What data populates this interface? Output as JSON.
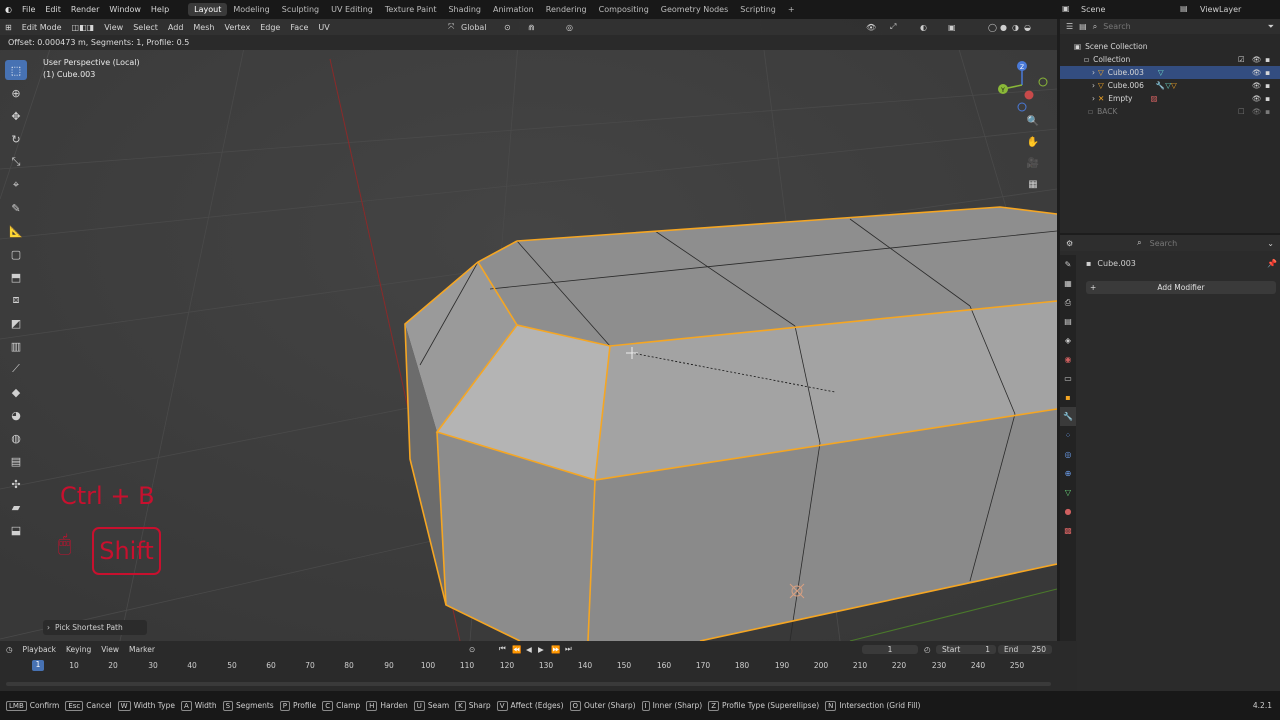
{
  "menubar": {
    "menus": [
      "File",
      "Edit",
      "Render",
      "Window",
      "Help"
    ],
    "workspaces": [
      "Layout",
      "Modeling",
      "Sculpting",
      "UV Editing",
      "Texture Paint",
      "Shading",
      "Animation",
      "Rendering",
      "Compositing",
      "Geometry Nodes",
      "Scripting"
    ],
    "active_workspace": "Layout",
    "scene": "Scene",
    "view_layer": "ViewLayer"
  },
  "viewport_header": {
    "mode": "Edit Mode",
    "menus": [
      "View",
      "Select",
      "Add",
      "Mesh",
      "Vertex",
      "Edge",
      "Face",
      "UV"
    ],
    "orientation": "Global"
  },
  "operator_status": "Offset: 0.000473 m, Segments: 1, Profile: 0.5",
  "viewport_overlay": {
    "view_name": "User Perspective (Local)",
    "object": "(1) Cube.003"
  },
  "gizmo_axes": {
    "z": "Z",
    "y": "Y"
  },
  "shortcut_overlay": {
    "combo": "Ctrl + B",
    "modifier": "Shift"
  },
  "last_operator_panel": "Pick Shortest Path",
  "outliner": {
    "search_placeholder": "Search",
    "scene_collection": "Scene Collection",
    "collection": "Collection",
    "items": [
      "Cube.003",
      "Cube.006",
      "Empty",
      "BACK"
    ]
  },
  "properties": {
    "search_placeholder": "Search",
    "object_name": "Cube.003",
    "add_modifier": "Add Modifier"
  },
  "timeline": {
    "menus": [
      "Playback",
      "Keying",
      "View",
      "Marker"
    ],
    "current_frame": "1",
    "start_label": "Start",
    "start": "1",
    "end_label": "End",
    "end": "250",
    "ticks": [
      "10",
      "20",
      "30",
      "40",
      "50",
      "60",
      "70",
      "80",
      "90",
      "100",
      "110",
      "120",
      "130",
      "140",
      "150",
      "160",
      "170",
      "180",
      "190",
      "200",
      "210",
      "220",
      "230",
      "240",
      "250"
    ]
  },
  "statusbar": {
    "hints": [
      {
        "key": "LMB",
        "label": "Confirm"
      },
      {
        "key": "Esc",
        "label": "Cancel"
      },
      {
        "key": "W",
        "label": "Width Type"
      },
      {
        "key": "A",
        "label": "Width"
      },
      {
        "key": "S",
        "label": "Segments"
      },
      {
        "key": "P",
        "label": "Profile"
      },
      {
        "key": "C",
        "label": "Clamp"
      },
      {
        "key": "H",
        "label": "Harden"
      },
      {
        "key": "U",
        "label": "Seam"
      },
      {
        "key": "K",
        "label": "Sharp"
      },
      {
        "key": "V",
        "label": "Affect (Edges)"
      },
      {
        "key": "O",
        "label": "Outer (Sharp)"
      },
      {
        "key": "I",
        "label": "Inner (Sharp)"
      },
      {
        "key": "Z",
        "label": "Profile Type (Superellipse)"
      },
      {
        "key": "N",
        "label": "Intersection (Grid Fill)"
      }
    ],
    "version": "4.2.1"
  },
  "colors": {
    "select_edge": "#f5a623",
    "accent_blue": "#4772b3",
    "overlay_red": "#c8102e"
  }
}
